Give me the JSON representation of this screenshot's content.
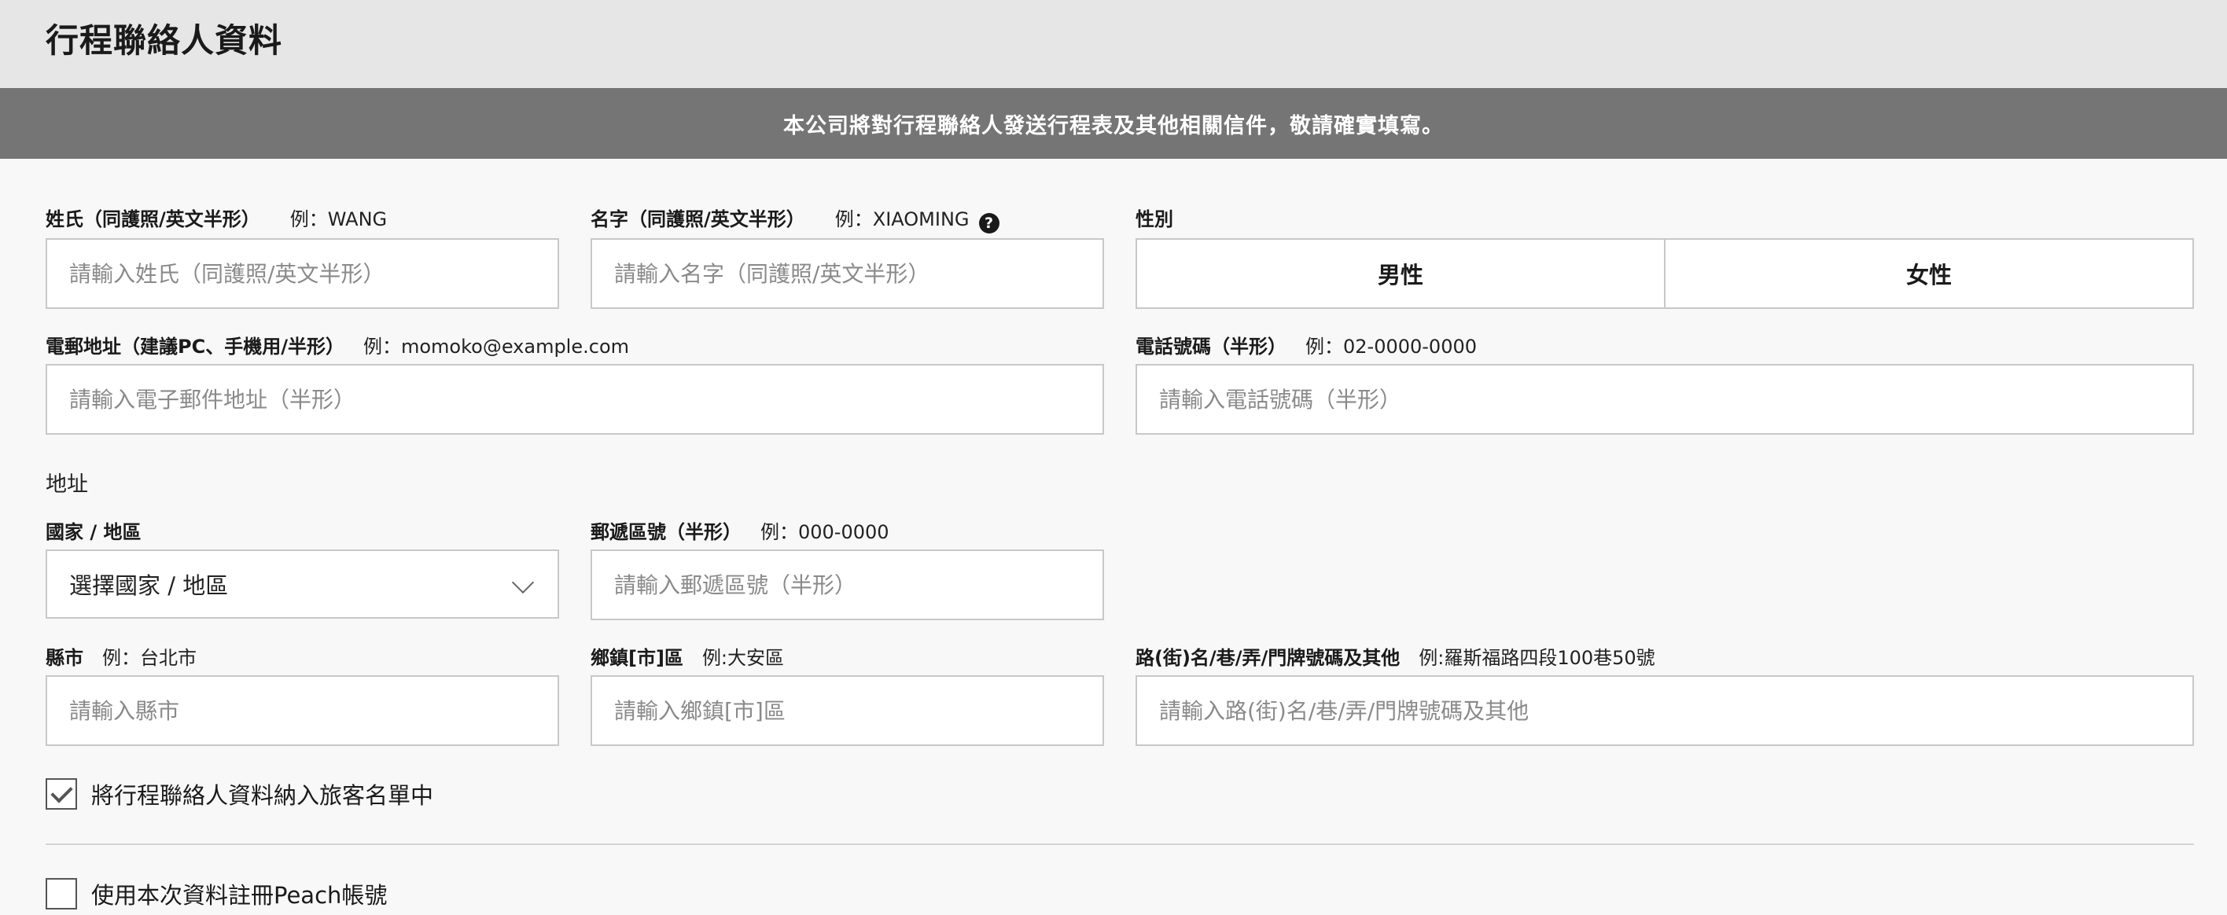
{
  "header": {
    "title": "行程聯絡人資料"
  },
  "notice": {
    "text": "本公司將對行程聯絡人發送行程表及其他相關信件，敬請確實填寫。"
  },
  "form": {
    "surname": {
      "label": "姓氏（同護照/英文半形）",
      "example": "例：WANG",
      "placeholder": "請輸入姓氏（同護照/英文半形）"
    },
    "given_name": {
      "label": "名字（同護照/英文半形）",
      "example": "例：XIAOMING",
      "help_icon_glyph": "?",
      "placeholder": "請輸入名字（同護照/英文半形）"
    },
    "gender": {
      "label": "性別",
      "options": [
        "男性",
        "女性"
      ]
    },
    "email": {
      "label": "電郵地址（建議PC、手機用/半形）",
      "example": "例：momoko@example.com",
      "placeholder": "請輸入電子郵件地址（半形）"
    },
    "phone": {
      "label": "電話號碼（半形）",
      "example": "例：02-0000-0000",
      "placeholder": "請輸入電話號碼（半形）"
    },
    "address_section": "地址",
    "country": {
      "label": "國家 / 地區",
      "selected": "選擇國家 / 地區"
    },
    "postal": {
      "label": "郵遞區號（半形）",
      "example": "例：000-0000",
      "placeholder": "請輸入郵遞區號（半形）"
    },
    "city": {
      "label": "縣市",
      "example": "例：台北市",
      "placeholder": "請輸入縣市"
    },
    "district": {
      "label": "鄉鎮[市]區",
      "example": "例:大安區",
      "placeholder": "請輸入鄉鎮[市]區"
    },
    "street": {
      "label": "路(街)名/巷/弄/門牌號碼及其他",
      "example": "例:羅斯福路四段100巷50號",
      "placeholder": "請輸入路(街)名/巷/弄/門牌號碼及其他"
    },
    "include_in_passengers": {
      "label": "將行程聯絡人資料納入旅客名單中",
      "checked": true
    },
    "register_account": {
      "label": "使用本次資料註冊Peach帳號",
      "checked": false
    }
  }
}
